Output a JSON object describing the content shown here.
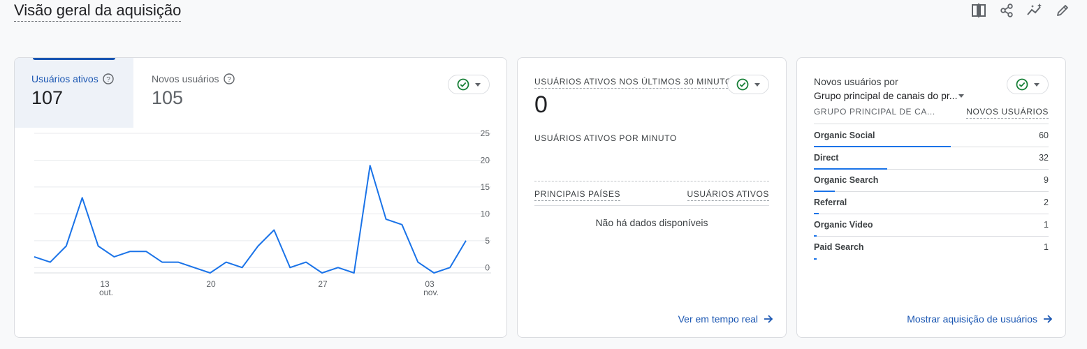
{
  "page": {
    "title": "Visão geral da aquisição"
  },
  "toolbar": {
    "icons": [
      "compare-icon",
      "share-icon",
      "insights-icon",
      "edit-icon"
    ]
  },
  "left_card": {
    "tabs": [
      {
        "label": "Usuários ativos",
        "value": "107",
        "active": true
      },
      {
        "label": "Novos usuários",
        "value": "105",
        "active": false
      }
    ],
    "chart_data": {
      "type": "line",
      "title": "",
      "xlabel": "",
      "ylabel": "",
      "ylim": [
        0,
        25
      ],
      "y_ticks": [
        "25",
        "20",
        "15",
        "10",
        "5",
        "0"
      ],
      "x_ticks": [
        {
          "day": "13",
          "month": "out."
        },
        {
          "day": "20",
          "month": ""
        },
        {
          "day": "27",
          "month": ""
        },
        {
          "day": "03",
          "month": "nov."
        }
      ],
      "series": [
        {
          "color": "#1a73e8",
          "values": [
            2,
            1,
            4,
            13,
            4,
            2,
            3,
            3,
            1,
            1,
            0,
            -1,
            1,
            0,
            4,
            7,
            0,
            1,
            -1,
            0,
            -1,
            19,
            9,
            8,
            1,
            -1,
            0,
            5
          ]
        }
      ],
      "grid": true
    }
  },
  "mid_card": {
    "heading": "USUÁRIOS ATIVOS NOS ÚLTIMOS 30 MINUTOS",
    "big_value": "0",
    "sub_heading": "USUÁRIOS ATIVOS POR MINUTO",
    "table_headers": [
      "PRINCIPAIS PAÍSES",
      "USUÁRIOS ATIVOS"
    ],
    "empty_text": "Não há dados disponíveis",
    "link": "Ver em tempo real"
  },
  "right_card": {
    "heading_line1": "Novos usuários por",
    "heading_line2": "Grupo principal de canais do pr...",
    "col_left": "GRUPO PRINCIPAL DE CA...",
    "col_right": "NOVOS USUÁRIOS",
    "rows": [
      {
        "name": "Organic Social",
        "value": "60",
        "share": 0.58
      },
      {
        "name": "Direct",
        "value": "32",
        "share": 0.31
      },
      {
        "name": "Organic Search",
        "value": "9",
        "share": 0.09
      },
      {
        "name": "Referral",
        "value": "2",
        "share": 0.02
      },
      {
        "name": "Organic Video",
        "value": "1",
        "share": 0.01
      },
      {
        "name": "Paid Search",
        "value": "1",
        "share": 0.01
      }
    ],
    "link": "Mostrar aquisição de usuários"
  },
  "colors": {
    "accent": "#1a73e8",
    "link": "#1a56b2",
    "check": "#188038"
  }
}
